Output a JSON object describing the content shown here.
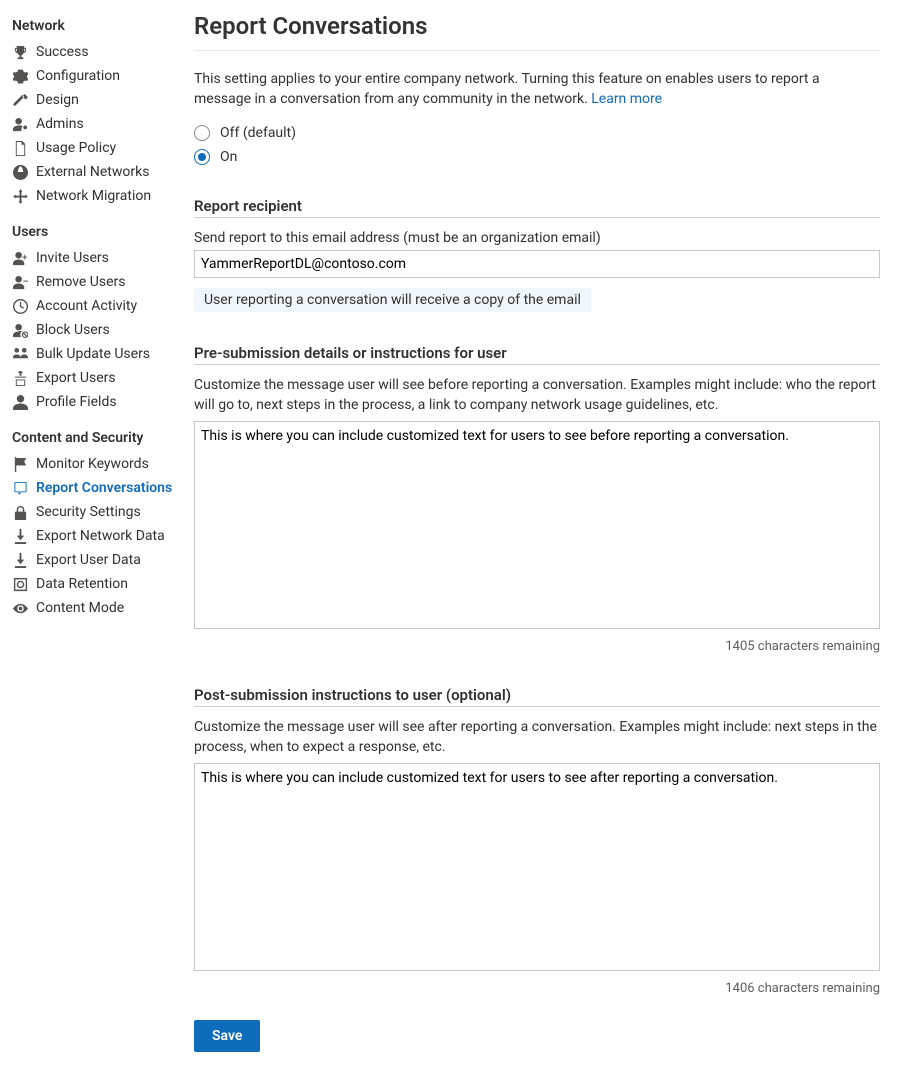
{
  "sidebar": {
    "groups": [
      {
        "title": "Network",
        "items": [
          {
            "label": "Success",
            "icon": "trophy-icon"
          },
          {
            "label": "Configuration",
            "icon": "gear-icon"
          },
          {
            "label": "Design",
            "icon": "design-icon"
          },
          {
            "label": "Admins",
            "icon": "admin-icon"
          },
          {
            "label": "Usage Policy",
            "icon": "document-icon"
          },
          {
            "label": "External Networks",
            "icon": "globe-icon"
          },
          {
            "label": "Network Migration",
            "icon": "migration-icon"
          }
        ]
      },
      {
        "title": "Users",
        "items": [
          {
            "label": "Invite Users",
            "icon": "add-user-icon"
          },
          {
            "label": "Remove Users",
            "icon": "remove-user-icon"
          },
          {
            "label": "Account Activity",
            "icon": "clock-icon"
          },
          {
            "label": "Block Users",
            "icon": "block-user-icon"
          },
          {
            "label": "Bulk Update Users",
            "icon": "bulk-users-icon"
          },
          {
            "label": "Export Users",
            "icon": "export-icon"
          },
          {
            "label": "Profile Fields",
            "icon": "profile-icon"
          }
        ]
      },
      {
        "title": "Content and Security",
        "items": [
          {
            "label": "Monitor Keywords",
            "icon": "flag-icon"
          },
          {
            "label": "Report Conversations",
            "icon": "report-icon",
            "selected": true
          },
          {
            "label": "Security Settings",
            "icon": "lock-icon"
          },
          {
            "label": "Export Network Data",
            "icon": "download-icon"
          },
          {
            "label": "Export User Data",
            "icon": "download-icon"
          },
          {
            "label": "Data Retention",
            "icon": "retention-icon"
          },
          {
            "label": "Content Mode",
            "icon": "eye-icon"
          }
        ]
      }
    ]
  },
  "page": {
    "title": "Report Conversations",
    "intro": "This setting applies to your entire company network. Turning this feature on enables users to report a message in a conversation from any community in the network. ",
    "intro_link": "Learn more",
    "radios": {
      "off_label": "Off (default)",
      "on_label": "On",
      "selected": "on"
    },
    "recipient": {
      "heading": "Report recipient",
      "label": "Send report to this email address (must be an organization email)",
      "value": "YammerReportDL@contoso.com",
      "help": "User reporting a conversation will receive a copy of the email"
    },
    "pre": {
      "heading": "Pre-submission details or instructions for user",
      "desc": "Customize the message user will see before reporting a conversation. Examples might include: who the report will go to, next steps in the process, a link to company network usage guidelines, etc.",
      "value": "This is where you can include customized text for users to see before reporting a conversation.",
      "remaining": "1405 characters remaining"
    },
    "post": {
      "heading": "Post-submission instructions to user (optional)",
      "desc": "Customize the message user will see after reporting a conversation. Examples might include: next steps in the process, when to expect a response, etc.",
      "value": "This is where you can include customized text for users to see after reporting a conversation.",
      "remaining": "1406 characters remaining"
    },
    "save_label": "Save"
  }
}
